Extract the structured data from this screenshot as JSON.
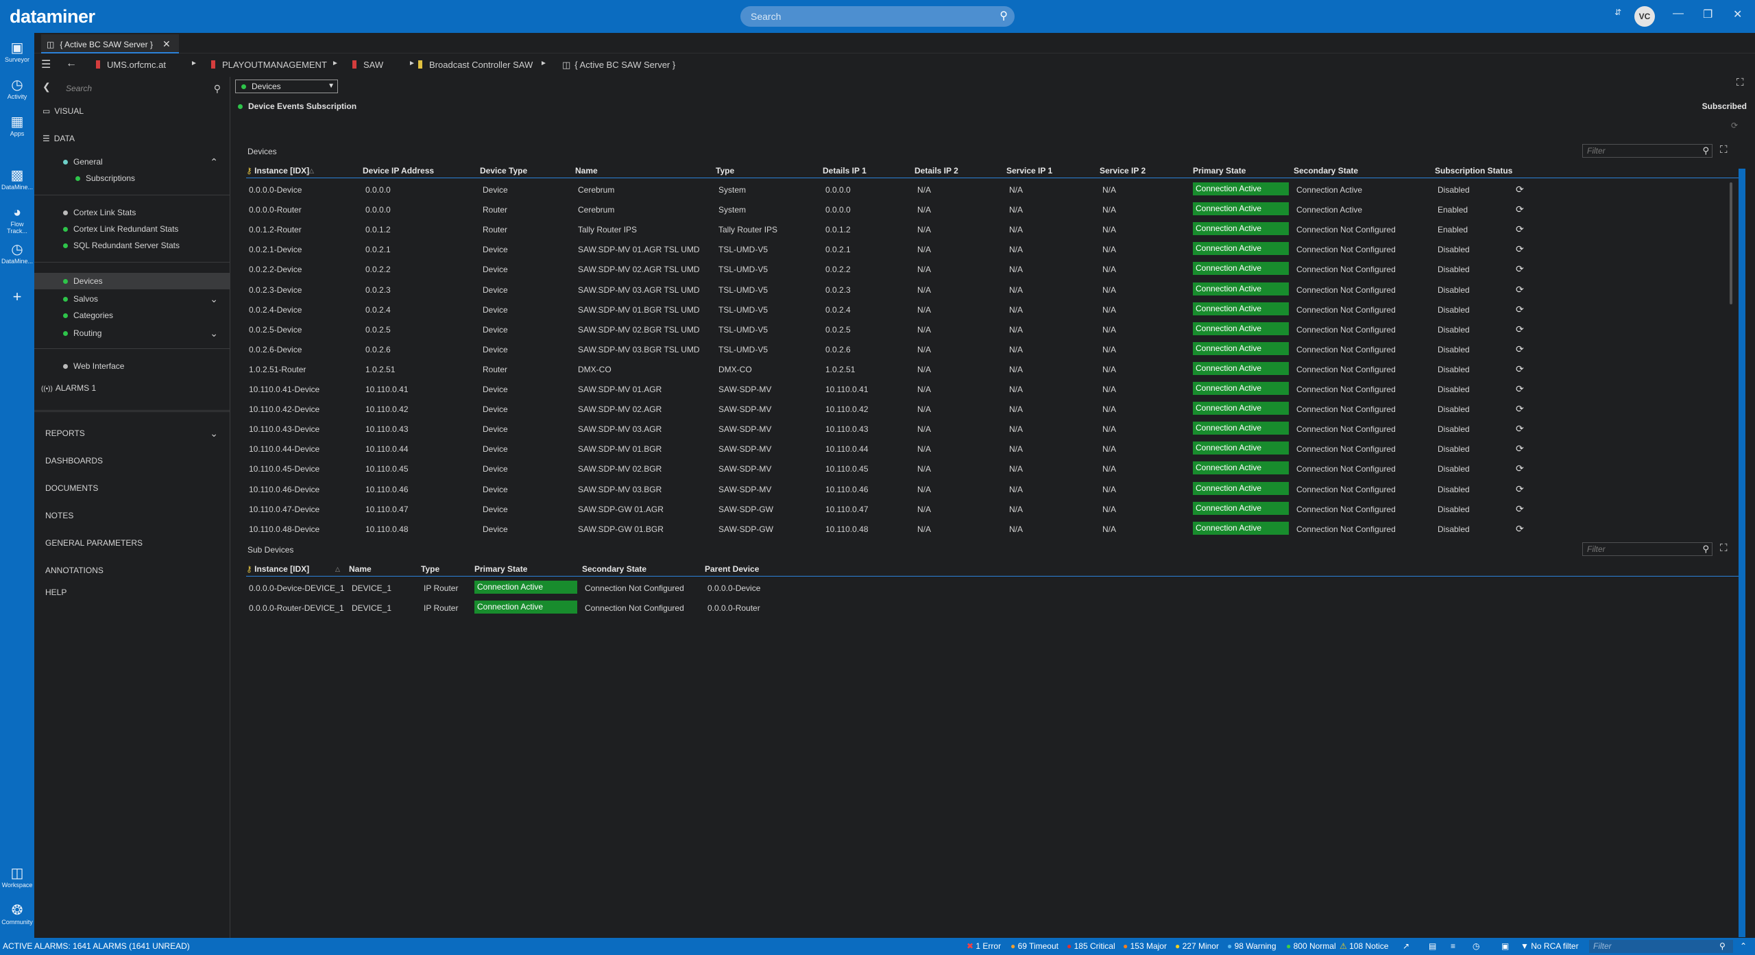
{
  "app": {
    "logo": "dataminer",
    "search_placeholder": "Search",
    "user_initials": "VC",
    "brand_color": "#0b6cc0"
  },
  "rail": [
    {
      "label": "Surveyor",
      "icon": "surveyor-icon"
    },
    {
      "label": "Activity",
      "icon": "activity-icon"
    },
    {
      "label": "Apps",
      "icon": "apps-icon"
    },
    {
      "label": "DataMine...",
      "icon": "datamine-icon"
    },
    {
      "label": "Flow Track...",
      "icon": "flow-tracking-icon"
    },
    {
      "label": "DataMine...",
      "icon": "datamine-history-icon"
    }
  ],
  "rail_bottom": [
    {
      "label": "Workspace",
      "icon": "workspace-icon"
    },
    {
      "label": "Community",
      "icon": "community-icon"
    }
  ],
  "tab": {
    "label": "{ Active BC SAW Server }"
  },
  "breadcrumb": [
    "UMS.orfcmc.at",
    "PLAYOUTMANAGEMENT",
    "SAW",
    "Broadcast Controller SAW",
    "{ Active BC SAW Server }"
  ],
  "sidebar": {
    "search_placeholder": "Search",
    "visual": "VISUAL",
    "data": "DATA",
    "general": "General",
    "subscriptions": "Subscriptions",
    "cortex_link_stats": "Cortex Link Stats",
    "cortex_link_redundant": "Cortex Link Redundant Stats",
    "sql_redundant": "SQL Redundant Server Stats",
    "devices": "Devices",
    "salvos": "Salvos",
    "categories": "Categories",
    "routing": "Routing",
    "web_interface": "Web Interface",
    "alarms": "ALARMS 1",
    "reports": "REPORTS",
    "dashboards": "DASHBOARDS",
    "documents": "DOCUMENTS",
    "notes": "NOTES",
    "general_parameters": "GENERAL PARAMETERS",
    "annotations": "ANNOTATIONS",
    "help": "HELP"
  },
  "main": {
    "page_select": "Devices",
    "event_subscription": "Device Events Subscription",
    "subscribed": "Subscribed",
    "devices_title": "Devices",
    "filter_placeholder": "Filter",
    "sub_devices_title": "Sub Devices"
  },
  "devices_table": {
    "headers": [
      "Instance [IDX]",
      "Device IP Address",
      "Device Type",
      "Name",
      "Type",
      "Details IP 1",
      "Details IP 2",
      "Service IP 1",
      "Service IP 2",
      "Primary State",
      "Secondary State",
      "Subscription Status"
    ],
    "rows": [
      [
        "0.0.0.0-Device",
        "0.0.0.0",
        "Device",
        "Cerebrum",
        "System",
        "0.0.0.0",
        "N/A",
        "N/A",
        "N/A",
        "Connection Active",
        "Connection Active",
        "Disabled"
      ],
      [
        "0.0.0.0-Router",
        "0.0.0.0",
        "Router",
        "Cerebrum",
        "System",
        "0.0.0.0",
        "N/A",
        "N/A",
        "N/A",
        "Connection Active",
        "Connection Active",
        "Enabled"
      ],
      [
        "0.0.1.2-Router",
        "0.0.1.2",
        "Router",
        "Tally Router IPS",
        "Tally Router IPS",
        "0.0.1.2",
        "N/A",
        "N/A",
        "N/A",
        "Connection Active",
        "Connection Not Configured",
        "Enabled"
      ],
      [
        "0.0.2.1-Device",
        "0.0.2.1",
        "Device",
        "SAW.SDP-MV 01.AGR TSL UMD",
        "TSL-UMD-V5",
        "0.0.2.1",
        "N/A",
        "N/A",
        "N/A",
        "Connection Active",
        "Connection Not Configured",
        "Disabled"
      ],
      [
        "0.0.2.2-Device",
        "0.0.2.2",
        "Device",
        "SAW.SDP-MV 02.AGR TSL UMD",
        "TSL-UMD-V5",
        "0.0.2.2",
        "N/A",
        "N/A",
        "N/A",
        "Connection Active",
        "Connection Not Configured",
        "Disabled"
      ],
      [
        "0.0.2.3-Device",
        "0.0.2.3",
        "Device",
        "SAW.SDP-MV 03.AGR TSL UMD",
        "TSL-UMD-V5",
        "0.0.2.3",
        "N/A",
        "N/A",
        "N/A",
        "Connection Active",
        "Connection Not Configured",
        "Disabled"
      ],
      [
        "0.0.2.4-Device",
        "0.0.2.4",
        "Device",
        "SAW.SDP-MV 01.BGR TSL UMD",
        "TSL-UMD-V5",
        "0.0.2.4",
        "N/A",
        "N/A",
        "N/A",
        "Connection Active",
        "Connection Not Configured",
        "Disabled"
      ],
      [
        "0.0.2.5-Device",
        "0.0.2.5",
        "Device",
        "SAW.SDP-MV 02.BGR TSL UMD",
        "TSL-UMD-V5",
        "0.0.2.5",
        "N/A",
        "N/A",
        "N/A",
        "Connection Active",
        "Connection Not Configured",
        "Disabled"
      ],
      [
        "0.0.2.6-Device",
        "0.0.2.6",
        "Device",
        "SAW.SDP-MV 03.BGR TSL UMD",
        "TSL-UMD-V5",
        "0.0.2.6",
        "N/A",
        "N/A",
        "N/A",
        "Connection Active",
        "Connection Not Configured",
        "Disabled"
      ],
      [
        "1.0.2.51-Router",
        "1.0.2.51",
        "Router",
        "DMX-CO",
        "DMX-CO",
        "1.0.2.51",
        "N/A",
        "N/A",
        "N/A",
        "Connection Active",
        "Connection Not Configured",
        "Disabled"
      ],
      [
        "10.110.0.41-Device",
        "10.110.0.41",
        "Device",
        "SAW.SDP-MV 01.AGR",
        "SAW-SDP-MV",
        "10.110.0.41",
        "N/A",
        "N/A",
        "N/A",
        "Connection Active",
        "Connection Not Configured",
        "Disabled"
      ],
      [
        "10.110.0.42-Device",
        "10.110.0.42",
        "Device",
        "SAW.SDP-MV 02.AGR",
        "SAW-SDP-MV",
        "10.110.0.42",
        "N/A",
        "N/A",
        "N/A",
        "Connection Active",
        "Connection Not Configured",
        "Disabled"
      ],
      [
        "10.110.0.43-Device",
        "10.110.0.43",
        "Device",
        "SAW.SDP-MV 03.AGR",
        "SAW-SDP-MV",
        "10.110.0.43",
        "N/A",
        "N/A",
        "N/A",
        "Connection Active",
        "Connection Not Configured",
        "Disabled"
      ],
      [
        "10.110.0.44-Device",
        "10.110.0.44",
        "Device",
        "SAW.SDP-MV 01.BGR",
        "SAW-SDP-MV",
        "10.110.0.44",
        "N/A",
        "N/A",
        "N/A",
        "Connection Active",
        "Connection Not Configured",
        "Disabled"
      ],
      [
        "10.110.0.45-Device",
        "10.110.0.45",
        "Device",
        "SAW.SDP-MV 02.BGR",
        "SAW-SDP-MV",
        "10.110.0.45",
        "N/A",
        "N/A",
        "N/A",
        "Connection Active",
        "Connection Not Configured",
        "Disabled"
      ],
      [
        "10.110.0.46-Device",
        "10.110.0.46",
        "Device",
        "SAW.SDP-MV 03.BGR",
        "SAW-SDP-MV",
        "10.110.0.46",
        "N/A",
        "N/A",
        "N/A",
        "Connection Active",
        "Connection Not Configured",
        "Disabled"
      ],
      [
        "10.110.0.47-Device",
        "10.110.0.47",
        "Device",
        "SAW.SDP-GW 01.AGR",
        "SAW-SDP-GW",
        "10.110.0.47",
        "N/A",
        "N/A",
        "N/A",
        "Connection Active",
        "Connection Not Configured",
        "Disabled"
      ],
      [
        "10.110.0.48-Device",
        "10.110.0.48",
        "Device",
        "SAW.SDP-GW 01.BGR",
        "SAW-SDP-GW",
        "10.110.0.48",
        "N/A",
        "N/A",
        "N/A",
        "Connection Active",
        "Connection Not Configured",
        "Disabled"
      ]
    ]
  },
  "sub_devices_table": {
    "headers": [
      "Instance [IDX]",
      "Name",
      "Type",
      "Primary State",
      "Secondary State",
      "Parent Device"
    ],
    "rows": [
      [
        "0.0.0.0-Device-DEVICE_1",
        "DEVICE_1",
        "IP Router",
        "Connection Active",
        "Connection Not Configured",
        "0.0.0.0-Device"
      ],
      [
        "0.0.0.0-Router-DEVICE_1",
        "DEVICE_1",
        "IP Router",
        "Connection Active",
        "Connection Not Configured",
        "0.0.0.0-Router"
      ]
    ]
  },
  "status": {
    "active_alarms": "ACTIVE ALARMS: 1641 ALARMS (1641 UNREAD)",
    "error": "1 Error",
    "timeout": "69 Timeout",
    "critical": "185 Critical",
    "major": "153 Major",
    "minor": "227 Minor",
    "warning": "98 Warning",
    "normal": "800 Normal",
    "notice": "108 Notice",
    "rca": "No RCA filter",
    "filter_placeholder": "Filter"
  },
  "colors": {
    "accent": "#0b6cc0",
    "active_green": "#188c2d",
    "background": "#1e1f21"
  }
}
